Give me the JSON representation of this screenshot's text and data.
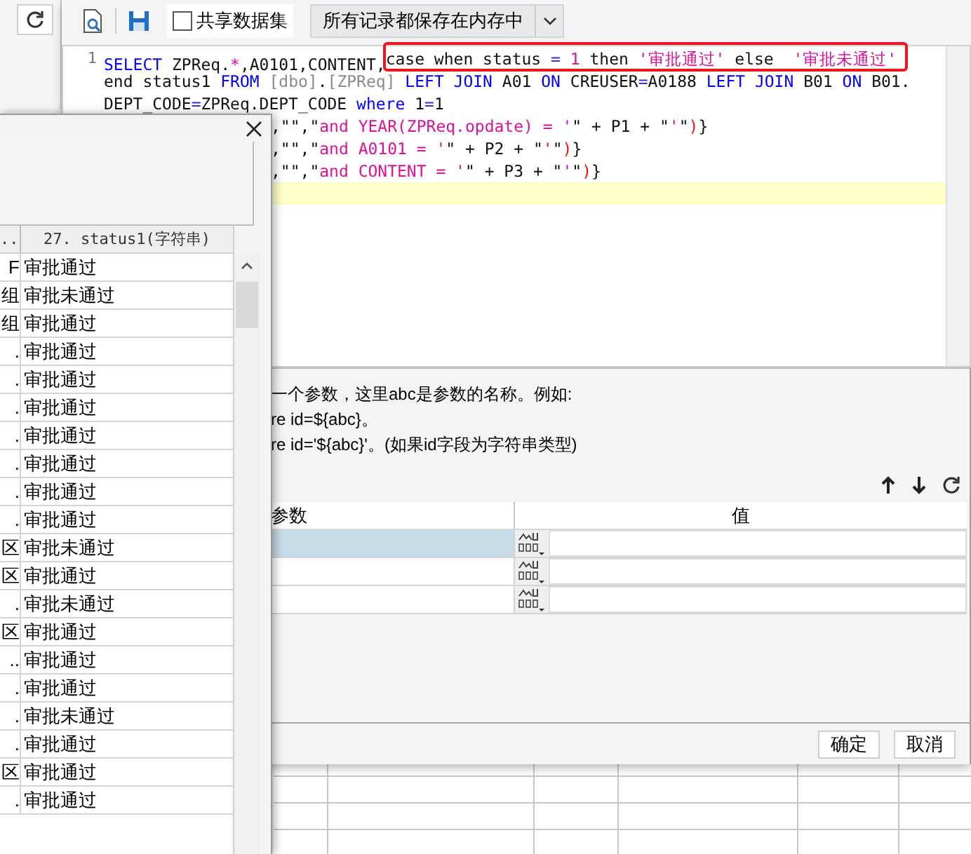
{
  "sql_dialog": {
    "toolbar": {
      "share_dataset": {
        "label": "共享数据集",
        "checked": false
      },
      "storage_mode": "所有记录都保存在内存中"
    },
    "editor": {
      "rows": [
        {
          "number": "1",
          "covered": false,
          "current": false,
          "tokens": [
            {
              "t": "SELECT",
              "kind": "kw"
            },
            {
              "t": " ZPReq.",
              "kind": "plain"
            },
            {
              "t": "*",
              "kind": "str"
            },
            {
              "t": ",A0101,CONTENT,",
              "kind": "plain"
            }
          ],
          "framed_tokens": [
            {
              "t": "case when status ",
              "kind": "plain"
            },
            {
              "t": "= ",
              "kind": "op"
            },
            {
              "t": "1",
              "kind": "num"
            },
            {
              "t": " then ",
              "kind": "plain"
            },
            {
              "t": "'审批通过'",
              "kind": "str"
            },
            {
              "t": " else  ",
              "kind": "plain"
            },
            {
              "t": "'审批未通过'",
              "kind": "str"
            }
          ]
        },
        {
          "covered": false,
          "current": false,
          "tokens": [
            {
              "t": "end status1 ",
              "kind": "plain"
            },
            {
              "t": "FROM ",
              "kind": "kw"
            },
            {
              "t": "[dbo]",
              "kind": "dim"
            },
            {
              "t": ".",
              "kind": "plain"
            },
            {
              "t": "[ZPReq] ",
              "kind": "dim"
            },
            {
              "t": "LEFT JOIN",
              "kind": "kw"
            },
            {
              "t": " A01 ",
              "kind": "plain"
            },
            {
              "t": "ON",
              "kind": "kw"
            },
            {
              "t": " CREUSER",
              "kind": "plain"
            },
            {
              "t": "=",
              "kind": "op"
            },
            {
              "t": "A0188 ",
              "kind": "plain"
            },
            {
              "t": "LEFT JOIN",
              "kind": "kw"
            },
            {
              "t": " B01 ",
              "kind": "plain"
            },
            {
              "t": "ON",
              "kind": "kw"
            },
            {
              "t": " B01.",
              "kind": "plain"
            }
          ]
        },
        {
          "covered": false,
          "current": false,
          "tokens": [
            {
              "t": "DEPT_CODE",
              "kind": "plain"
            },
            {
              "t": "=",
              "kind": "op"
            },
            {
              "t": "ZPReq.DEPT_CODE ",
              "kind": "plain"
            },
            {
              "t": "where",
              "kind": "kw"
            },
            {
              "t": " 1",
              "kind": "plain"
            },
            {
              "t": "=",
              "kind": "op"
            },
            {
              "t": "1",
              "kind": "plain"
            }
          ]
        },
        {
          "covered": true,
          "current": false,
          "tokens": [
            {
              "t": ",\"\",\"",
              "kind": "plain"
            },
            {
              "t": "and YEAR(ZPReq.opdate) = '",
              "kind": "str"
            },
            {
              "t": "\" + P1 + \"",
              "kind": "plain"
            },
            {
              "t": "'",
              "kind": "str"
            },
            {
              "t": "\"",
              "kind": "plain"
            },
            {
              "t": ")",
              "kind": "paren"
            },
            {
              "t": "}",
              "kind": "plain"
            }
          ]
        },
        {
          "covered": true,
          "current": false,
          "tokens": [
            {
              "t": ",\"\",\"",
              "kind": "plain"
            },
            {
              "t": "and A0101 = '",
              "kind": "str"
            },
            {
              "t": "\" + P2 + \"",
              "kind": "plain"
            },
            {
              "t": "'",
              "kind": "str"
            },
            {
              "t": "\"",
              "kind": "plain"
            },
            {
              "t": ")",
              "kind": "paren"
            },
            {
              "t": "}",
              "kind": "plain"
            }
          ]
        },
        {
          "covered": true,
          "current": false,
          "tokens": [
            {
              "t": ",\"\",\"",
              "kind": "plain"
            },
            {
              "t": "and CONTENT = '",
              "kind": "str"
            },
            {
              "t": "\" + P3 + \"",
              "kind": "plain"
            },
            {
              "t": "'",
              "kind": "str"
            },
            {
              "t": "\"",
              "kind": "plain"
            },
            {
              "t": ")",
              "kind": "paren"
            },
            {
              "t": "}",
              "kind": "plain"
            }
          ]
        },
        {
          "covered": true,
          "current": true
        }
      ]
    },
    "help_lines": [
      "一个参数，这里abc是参数的名称。例如:",
      "re id=${abc}。",
      "re id='${abc}'。(如果id字段为字符串类型)"
    ],
    "parameters": {
      "columns": [
        "参数",
        "值"
      ],
      "rows": [
        {
          "selected": true
        },
        {
          "selected": false
        },
        {
          "selected": false
        }
      ]
    },
    "buttons": [
      "确定",
      "取消"
    ]
  },
  "preview_window": {
    "columns": [
      "..",
      "27. status1(字符串)"
    ],
    "rows": [
      {
        "cells": [
          "F",
          "审批通过"
        ]
      },
      {
        "cells": [
          "组",
          "审批未通过"
        ]
      },
      {
        "cells": [
          "组",
          "审批通过"
        ]
      },
      {
        "cells": [
          ".",
          "审批通过"
        ]
      },
      {
        "cells": [
          ".",
          "审批通过"
        ]
      },
      {
        "cells": [
          ".",
          "审批通过"
        ]
      },
      {
        "cells": [
          ".",
          "审批通过"
        ]
      },
      {
        "cells": [
          ".",
          "审批通过"
        ]
      },
      {
        "cells": [
          ".",
          "审批通过"
        ]
      },
      {
        "cells": [
          ".",
          "审批通过"
        ]
      },
      {
        "cells": [
          "区",
          "审批未通过"
        ]
      },
      {
        "cells": [
          "区",
          "审批通过"
        ]
      },
      {
        "cells": [
          ".",
          "审批未通过"
        ]
      },
      {
        "cells": [
          "区",
          "审批通过"
        ]
      },
      {
        "cells": [
          "..",
          "审批通过"
        ]
      },
      {
        "cells": [
          ".",
          "审批通过"
        ]
      },
      {
        "cells": [
          ".",
          "审批未通过"
        ]
      },
      {
        "cells": [
          ".",
          "审批通过"
        ]
      },
      {
        "cells": [
          "区",
          "审批通过"
        ]
      },
      {
        "cells": [
          ".",
          "审批通过"
        ]
      }
    ]
  }
}
